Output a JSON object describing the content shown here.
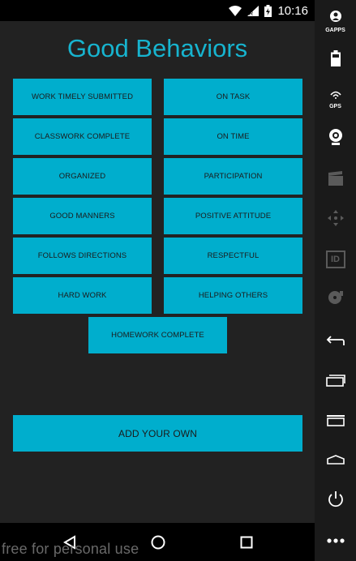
{
  "status": {
    "time": "10:16"
  },
  "app": {
    "title": "Good Behaviors"
  },
  "buttons": {
    "work_timely": "WORK TIMELY SUBMITTED",
    "on_task": "ON TASK",
    "classwork": "CLASSWORK COMPLETE",
    "on_time": "ON TIME",
    "organized": "ORGANIZED",
    "participation": "PARTICIPATION",
    "manners": "GOOD MANNERS",
    "positive": "POSITIVE ATTITUDE",
    "follows": "FOLLOWS DIRECTIONS",
    "respectful": "RESPECTFUL",
    "hard_work": "HARD WORK",
    "helping": "HELPING OTHERS",
    "homework": "HOMEWORK COMPLETE",
    "add_own": "ADD YOUR OWN"
  },
  "watermark": "free for personal use",
  "side_panel": {
    "gapps_label": "GAPPS",
    "gps_label": "GPS",
    "id_label": "ID"
  },
  "colors": {
    "accent": "#00aecd",
    "title": "#17b4cf",
    "background": "#222222"
  }
}
